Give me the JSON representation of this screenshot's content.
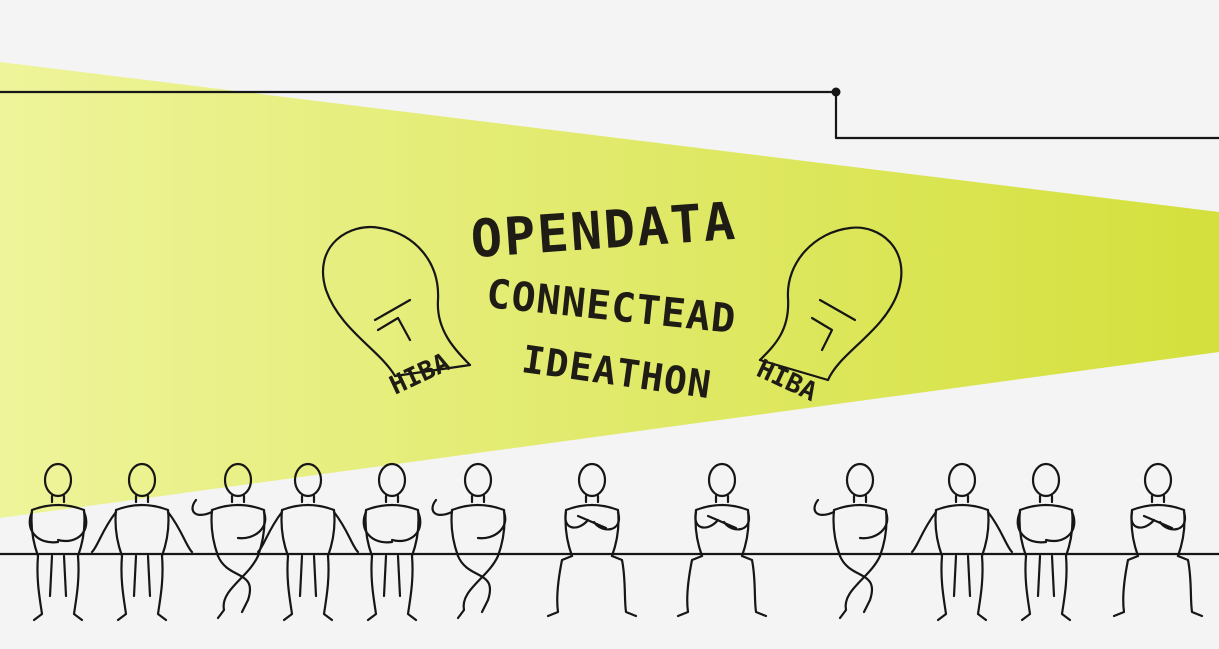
{
  "banner": {
    "title_line1": "OPENDATA",
    "title_line2": "CONNECTEAD",
    "title_line3": "IDEATHON",
    "bulb_lettering": "HIBA"
  },
  "colors": {
    "background": "#f4f4f4",
    "beam_start": "#eef49a",
    "beam_end": "#d4e03c",
    "ink": "#161616"
  },
  "people": [
    {
      "name": "person-1"
    },
    {
      "name": "person-2"
    },
    {
      "name": "person-3"
    },
    {
      "name": "person-4"
    },
    {
      "name": "person-5"
    },
    {
      "name": "person-6"
    },
    {
      "name": "person-7"
    },
    {
      "name": "person-8"
    },
    {
      "name": "person-9"
    },
    {
      "name": "person-10"
    },
    {
      "name": "person-11"
    },
    {
      "name": "person-12"
    }
  ]
}
